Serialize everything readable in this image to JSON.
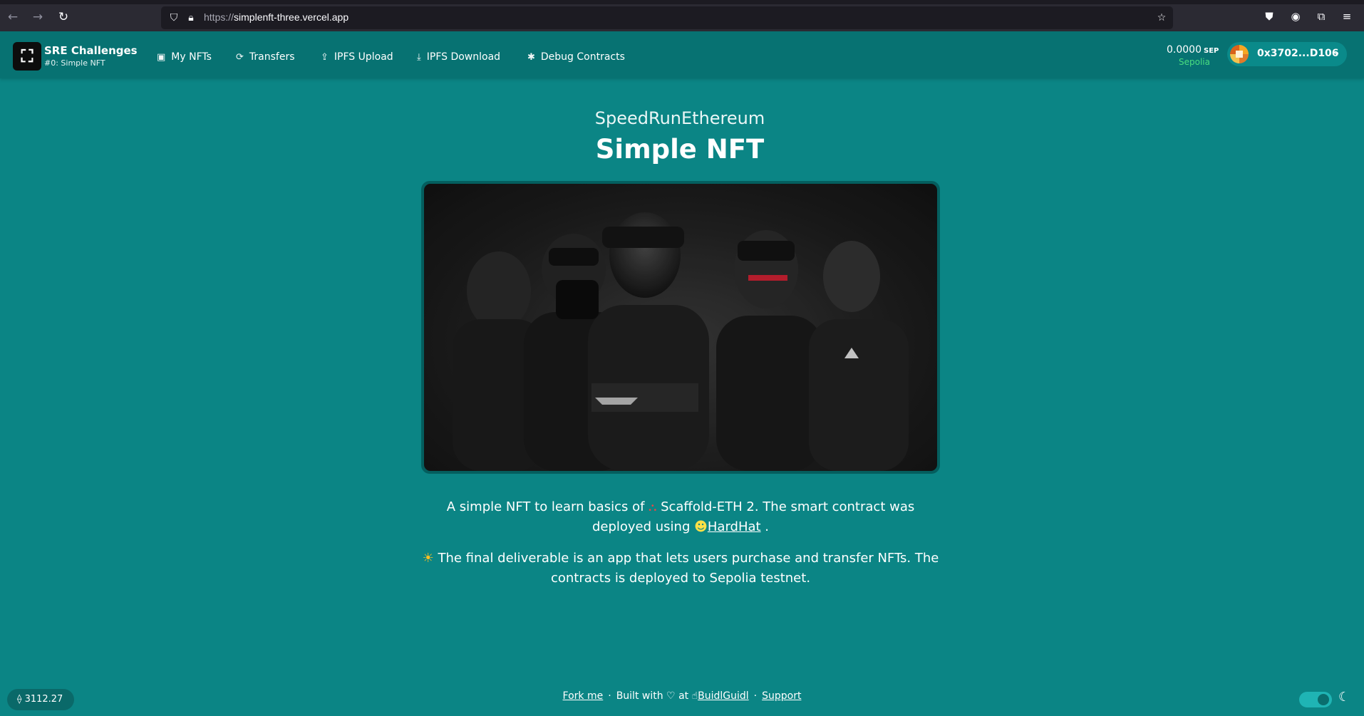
{
  "browser": {
    "url_prefix": "https://",
    "url_host": "simplenft-three.vercel.app",
    "icons": [
      "back-icon",
      "forward-icon",
      "reload-icon",
      "shield-icon",
      "lock-icon",
      "bookmark-star-icon",
      "pocket-icon",
      "account-icon",
      "extensions-icon",
      "menu-icon"
    ]
  },
  "header": {
    "brand_title": "SRE Challenges",
    "brand_subtitle": "#0: Simple NFT",
    "nav": [
      {
        "label": "My NFTs",
        "icon": "image-icon"
      },
      {
        "label": "Transfers",
        "icon": "refresh-icon"
      },
      {
        "label": "IPFS Upload",
        "icon": "upload-icon"
      },
      {
        "label": "IPFS Download",
        "icon": "download-icon"
      },
      {
        "label": "Debug Contracts",
        "icon": "bug-icon"
      }
    ],
    "balance": "0.0000",
    "balance_unit": "SEP",
    "network": "Sepolia",
    "account": "0x3702...D106"
  },
  "main": {
    "subtitle": "SpeedRunEthereum",
    "title": "Simple NFT",
    "para1_a": "A simple NFT to learn basics of ",
    "para1_b": " Scaffold-ETH 2. The smart contract was deployed using ",
    "para1_link": "HardHat",
    "para1_end": " .",
    "para2": " The final deliverable is an app that lets users purchase and transfer NFTs. The contracts is deployed to Sepolia testnet."
  },
  "footer": {
    "price": "3112.27",
    "fork": "Fork me",
    "built_with": "Built with",
    "at": "at",
    "buidlguidl": "BuidlGuidl",
    "support": "Support"
  },
  "colors": {
    "page_bg": "#0b8585",
    "header_bg": "#077272",
    "network": "#4ade80"
  }
}
